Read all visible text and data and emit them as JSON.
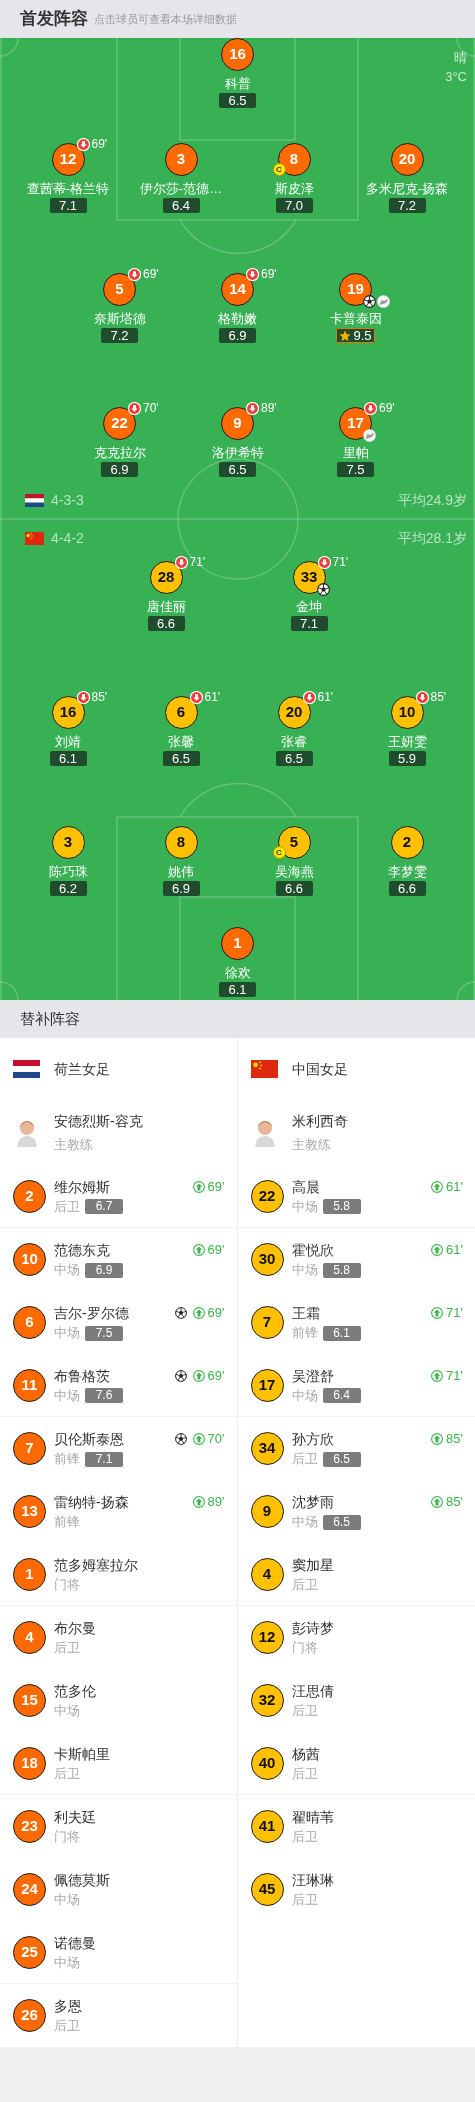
{
  "starting": {
    "title": "首发阵容",
    "hint": "点击球员可查看本场详细数据",
    "weather": {
      "condition": "晴",
      "temperature": "3°C"
    },
    "home": {
      "lines": [
        [
          {
            "number": "16",
            "name": "科普",
            "rating": "6.5",
            "color": "#ff6a00",
            "best": false
          }
        ],
        [
          {
            "number": "12",
            "name": "查茜蒂-格兰特",
            "rating": "7.1",
            "color": "#ff6a00",
            "best": false,
            "sub_off": "69'"
          },
          {
            "number": "3",
            "name": "伊尔莎-范德…",
            "rating": "6.4",
            "color": "#ff6a00",
            "best": false
          },
          {
            "number": "8",
            "name": "斯皮泽",
            "rating": "7.0",
            "color": "#ff6a00",
            "best": false,
            "captain_badge": "C"
          },
          {
            "number": "20",
            "name": "多米尼克-扬森",
            "rating": "7.2",
            "color": "#ff6a00",
            "best": false
          }
        ],
        [
          {
            "number": "5",
            "name": "奈斯塔德",
            "rating": "7.2",
            "color": "#ff6a00",
            "best": false,
            "sub_off": "69'"
          },
          {
            "number": "14",
            "name": "格勒嫩",
            "rating": "6.9",
            "color": "#ff6a00",
            "best": false,
            "sub_off": "69'"
          },
          {
            "number": "19",
            "name": "卡普泰因",
            "rating": "9.5",
            "color": "#ff6a00",
            "best": true,
            "events": [
              {
                "kind": "goal"
              },
              {
                "kind": "assist"
              }
            ]
          }
        ],
        [
          {
            "number": "22",
            "name": "克克拉尔",
            "rating": "6.9",
            "color": "#ff6a00",
            "best": false,
            "sub_off": "70'"
          },
          {
            "number": "9",
            "name": "洛伊希特",
            "rating": "6.5",
            "color": "#ff6a00",
            "best": false,
            "sub_off": "89'"
          },
          {
            "number": "17",
            "name": "里帕",
            "rating": "7.5",
            "color": "#ff6a00",
            "best": false,
            "sub_off": "69'",
            "events": [
              {
                "kind": "assist"
              }
            ]
          }
        ]
      ]
    },
    "home_formation": {
      "flag": {
        "kind": "nl"
      },
      "formation": "4-3-3",
      "average_age": "平均24.9岁"
    },
    "away_formation": {
      "flag": {
        "kind": "cn"
      },
      "formation": "4-4-2",
      "average_age": "平均28.1岁"
    },
    "away": {
      "lines": [
        [
          {
            "number": "28",
            "name": "唐佳丽",
            "rating": "6.6",
            "color": "#ffc000",
            "best": false,
            "sub_off": "71'"
          },
          {
            "number": "33",
            "name": "金坤",
            "rating": "7.1",
            "color": "#ffc000",
            "best": false,
            "sub_off": "71'",
            "events": [
              {
                "kind": "goal"
              }
            ]
          }
        ],
        [
          {
            "number": "16",
            "name": "刘靖",
            "rating": "6.1",
            "color": "#ffc000",
            "best": false,
            "sub_off": "85'"
          },
          {
            "number": "6",
            "name": "张馨",
            "rating": "6.5",
            "color": "#ffc000",
            "best": false,
            "sub_off": "61'"
          },
          {
            "number": "20",
            "name": "张睿",
            "rating": "6.5",
            "color": "#ffc000",
            "best": false,
            "sub_off": "61'"
          },
          {
            "number": "10",
            "name": "王妍雯",
            "rating": "5.9",
            "color": "#ffc000",
            "best": false,
            "sub_off": "85'"
          }
        ],
        [
          {
            "number": "3",
            "name": "陈巧珠",
            "rating": "6.2",
            "color": "#ffc000",
            "best": false
          },
          {
            "number": "8",
            "name": "姚伟",
            "rating": "6.9",
            "color": "#ffc000",
            "best": false
          },
          {
            "number": "5",
            "name": "吴海燕",
            "rating": "6.6",
            "color": "#ffc000",
            "best": false,
            "captain_badge": "C"
          },
          {
            "number": "2",
            "name": "李梦雯",
            "rating": "6.6",
            "color": "#ffc000",
            "best": false
          }
        ],
        [
          {
            "number": "1",
            "name": "徐欢",
            "rating": "6.1",
            "color": "#ff6a00",
            "best": false
          }
        ]
      ]
    }
  },
  "substitutes": {
    "title": "替补阵容",
    "teams": [
      {
        "flag": {
          "kind": "nl"
        },
        "name": "荷兰女足",
        "color": "#ff6a00",
        "coach": {
          "name": "安德烈斯-容克",
          "role": "主教练"
        },
        "players": [
          {
            "number": "2",
            "name": "维尔姆斯",
            "position": "后卫",
            "rating": "6.7",
            "sub_on": "69'"
          },
          {
            "number": "10",
            "name": "范德东克",
            "position": "中场",
            "rating": "6.9",
            "sub_on": "69'"
          },
          {
            "number": "6",
            "name": "吉尔-罗尔德",
            "position": "中场",
            "rating": "7.5",
            "sub_on": "69'",
            "events": [
              {
                "kind": "goal"
              }
            ]
          },
          {
            "number": "11",
            "name": "布鲁格茨",
            "position": "中场",
            "rating": "7.6",
            "sub_on": "69'",
            "events": [
              {
                "kind": "goal"
              }
            ]
          },
          {
            "number": "7",
            "name": "贝伦斯泰恩",
            "position": "前锋",
            "rating": "7.1",
            "sub_on": "70'",
            "events": [
              {
                "kind": "goal"
              }
            ]
          },
          {
            "number": "13",
            "name": "雷纳特-扬森",
            "position": "前锋",
            "sub_on": "89'"
          },
          {
            "number": "1",
            "name": "范多姆塞拉尔",
            "position": "门将"
          },
          {
            "number": "4",
            "name": "布尔曼",
            "position": "后卫"
          },
          {
            "number": "15",
            "name": "范多伦",
            "position": "中场"
          },
          {
            "number": "18",
            "name": "卡斯帕里",
            "position": "后卫"
          },
          {
            "number": "23",
            "name": "利夫廷",
            "position": "门将"
          },
          {
            "number": "24",
            "name": "佩德莫斯",
            "position": "中场"
          },
          {
            "number": "25",
            "name": "诺德曼",
            "position": "中场"
          },
          {
            "number": "26",
            "name": "多恩",
            "position": "后卫"
          }
        ]
      },
      {
        "flag": {
          "kind": "cn"
        },
        "name": "中国女足",
        "color": "#ffc000",
        "coach": {
          "name": "米利西奇",
          "role": "主教练"
        },
        "players": [
          {
            "number": "22",
            "name": "高晨",
            "position": "中场",
            "rating": "5.8",
            "sub_on": "61'"
          },
          {
            "number": "30",
            "name": "霍悦欣",
            "position": "中场",
            "rating": "5.8",
            "sub_on": "61'"
          },
          {
            "number": "7",
            "name": "王霜",
            "position": "前锋",
            "rating": "6.1",
            "sub_on": "71'"
          },
          {
            "number": "17",
            "name": "吴澄舒",
            "position": "中场",
            "rating": "6.4",
            "sub_on": "71'"
          },
          {
            "number": "34",
            "name": "孙方欣",
            "position": "后卫",
            "rating": "6.5",
            "sub_on": "85'"
          },
          {
            "number": "9",
            "name": "沈梦雨",
            "position": "中场",
            "rating": "6.5",
            "sub_on": "85'"
          },
          {
            "number": "4",
            "name": "窦加星",
            "position": "后卫"
          },
          {
            "number": "12",
            "name": "彭诗梦",
            "position": "门将"
          },
          {
            "number": "32",
            "name": "汪思倩",
            "position": "后卫"
          },
          {
            "number": "40",
            "name": "杨茜",
            "position": "后卫"
          },
          {
            "number": "41",
            "name": "翟晴苇",
            "position": "后卫"
          },
          {
            "number": "45",
            "name": "汪琳琳",
            "position": "后卫"
          }
        ]
      }
    ]
  }
}
